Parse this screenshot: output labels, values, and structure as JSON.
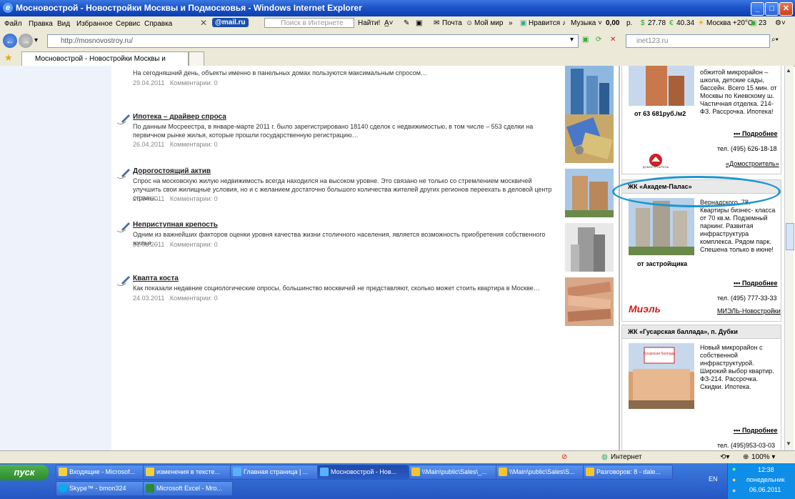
{
  "window": {
    "title": "Мосновострой - Новостройки Москвы и Подмосковья - Windows Internet Explorer"
  },
  "menu": [
    "Файл",
    "Правка",
    "Вид",
    "Избранное",
    "Сервис",
    "Справка"
  ],
  "toolbar": {
    "mailru": "@mail.ru",
    "search_placeholder": "Поиск в Интернете",
    "find": "Найти!",
    "mail": "Почта",
    "myworld": "Мой мир",
    "like": "Нравится",
    "music": "Музыка",
    "balance": "0,00",
    "currency": "р.",
    "usd": "27.78",
    "eur": "40.34",
    "weather": "Москва +20°C",
    "count": "23"
  },
  "address": {
    "url": "http://mosnovostroy.ru/",
    "search_placeholder": "inet123.ru"
  },
  "tab": {
    "label": "Мосновострой - Новостройки Москвы и Подмосковья"
  },
  "news": [
    {
      "title": "",
      "desc": "На сегодняшний день, объекты именно в панельных домах пользуются максимальным спросом…",
      "date": "29.04.2011",
      "comments": "Комментарии: 0"
    },
    {
      "title": "Ипотека – драйвер спроса",
      "desc": "По данным Мосреестра, в январе-марте 2011 г. было зарегистрировано 18140 сделок с недвижимостью, в том числе – 553 сделки на первичном рынке жилья, которые прошли государственную регистрацию…",
      "date": "26.04.2011",
      "comments": "Комментарии: 0"
    },
    {
      "title": "Дорогостоящий актив",
      "desc": "Спрос на московскую жилую недвижимость всегда находился на высоком уровне. Это связано не только со стремлением москвичей улучшить свои жилищные условия, но и с желанием достаточно большого количества жителей других регионов переехать в деловой центр страны…",
      "date": "26.04.2011",
      "comments": "Комментарии: 0"
    },
    {
      "title": "Неприступная крепость",
      "desc": "Одним из важнейших факторов оценки уровня качества жизни столичного населения, является возможность приобретения собственного жилья…",
      "date": "31.03.2011",
      "comments": "Комментарии: 0"
    },
    {
      "title": "Квапта коста",
      "desc": "Как показали недавние социологические опросы, большинство москвичей не представляют, сколько может стоить квартира в Москве…",
      "date": "24.03.2011",
      "comments": "Комментарии: 0"
    }
  ],
  "ads": {
    "ad1": {
      "text": "обжитой микрорайон – школа, детские сады, бассейн. Всего 15 мин. от Москвы по Киевскому ш. Частичная отделка. 214-ФЗ. Рассрочка. Ипотека!",
      "price": "от 63 681руб./м2",
      "more": "Подробнее",
      "phone": "тел. (495) 626-18-18",
      "logo": "ДОМОСТРОИТЕЛЬ",
      "dev": "«Домостроитель»"
    },
    "ad2": {
      "title": "ЖК «Академ-Палас»",
      "text": "Вернадского, 78. Квартиры бизнес- класса от 70 кв.м. Подземный паркинг. Развитая инфраструктура комплекса. Рядом парк. Спешена только в июне!",
      "price": "от застройщика",
      "more": "Подробнее",
      "phone": "тел. (495) 777-33-33",
      "logo": "Миэль",
      "dev": "МИЭЛЬ-Новостройки"
    },
    "ad3": {
      "title": "ЖК «Гусарская баллада», п. Дубки",
      "text": "Новый микрорайон с собственной инфраструктурой. Широкий выбор квартир. ФЗ-214. Рассрочка. Скидки. Ипотека.",
      "logo": "Гусарская баллада",
      "more": "Подробнее",
      "phone": "тел. (495)953-03-03"
    }
  },
  "status": {
    "zone": "Интернет",
    "zoom": "100%"
  },
  "taskbar": {
    "start": "пуск",
    "row1": [
      "Входящие - Microsof...",
      "изменения в тексте...",
      "Главная страница | ...",
      "Мосновострой - Нов...",
      "\\\\Main\\public\\Sales\\_...",
      "\\\\Main\\public\\Sales\\S...",
      "Разговоров: 8 - dale..."
    ],
    "row2": [
      "Skype™ - bmon324",
      "Microsoft Excel - Mro..."
    ],
    "lang": "EN",
    "time": "12:38",
    "day": "понедельник",
    "date": "06.06.2011"
  }
}
